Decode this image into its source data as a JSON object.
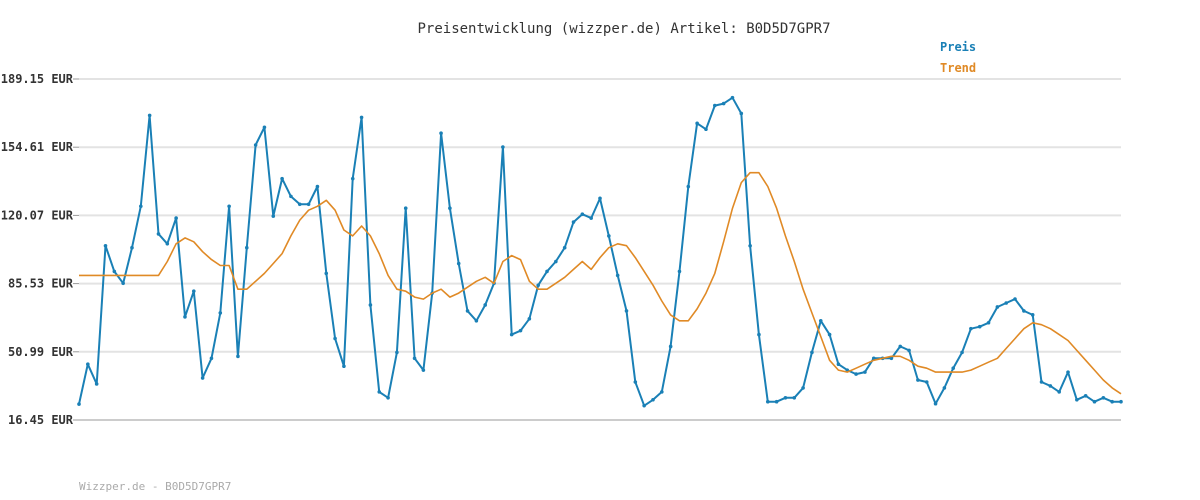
{
  "chart_data": {
    "type": "line",
    "title": "Preisentwicklung (wizzper.de) Artikel: B0D5D7GPR7",
    "xlabel": "",
    "ylabel": "",
    "ylim": [
      16.45,
      189.15
    ],
    "yticks": [
      "189.15 EUR",
      "154.61 EUR",
      "120.07 EUR",
      "85.53 EUR",
      "50.99 EUR",
      "16.45 EUR"
    ],
    "ytick_values": [
      189.15,
      154.61,
      120.07,
      85.53,
      50.99,
      16.45
    ],
    "grid": true,
    "legend_position": "top-right",
    "series": [
      {
        "name": "Preis",
        "color": "#1a80b6",
        "values": [
          24.5,
          44.7,
          34.7,
          104.7,
          91.7,
          85.7,
          103.7,
          124.7,
          170.7,
          110.7,
          105.7,
          118.7,
          68.7,
          81.7,
          37.7,
          47.7,
          70.7,
          124.7,
          48.7,
          103.7,
          155.7,
          164.7,
          119.7,
          138.7,
          129.7,
          125.7,
          125.7,
          134.7,
          90.7,
          57.7,
          43.7,
          138.7,
          169.7,
          74.7,
          30.7,
          27.7,
          50.7,
          123.7,
          47.7,
          41.7,
          80.7,
          161.7,
          123.7,
          95.7,
          71.7,
          66.7,
          74.7,
          85.7,
          154.7,
          59.7,
          61.7,
          67.7,
          84.7,
          91.7,
          96.7,
          103.7,
          116.7,
          120.7,
          118.7,
          128.7,
          109.7,
          89.7,
          71.7,
          35.7,
          23.7,
          26.7,
          30.7,
          53.7,
          91.7,
          134.7,
          166.7,
          163.7,
          175.7,
          176.7,
          179.7,
          171.7,
          104.7,
          59.7,
          25.7,
          25.7,
          27.7,
          27.7,
          32.7,
          50.7,
          66.7,
          59.7,
          44.7,
          41.7,
          39.7,
          40.7,
          47.7,
          47.7,
          47.7,
          53.7,
          51.7,
          36.7,
          35.7,
          24.7,
          32.7,
          42.7,
          50.7,
          62.7,
          63.7,
          65.7,
          73.7,
          75.7,
          77.7,
          71.7,
          69.7,
          35.7,
          33.7,
          30.7,
          40.7,
          26.7,
          28.7,
          25.7,
          27.7,
          25.7,
          25.7
        ]
      },
      {
        "name": "Trend",
        "color": "#e08a26",
        "values": [
          89.7,
          89.7,
          89.7,
          89.7,
          89.7,
          89.7,
          89.7,
          89.7,
          89.7,
          89.7,
          96.7,
          105.7,
          108.7,
          106.7,
          101.7,
          97.7,
          94.7,
          94.7,
          82.7,
          82.7,
          86.7,
          90.7,
          95.7,
          100.7,
          109.7,
          117.7,
          122.7,
          124.7,
          127.7,
          122.7,
          112.7,
          109.7,
          114.7,
          109.7,
          100.7,
          89.7,
          82.7,
          81.7,
          78.7,
          77.7,
          80.7,
          82.7,
          78.7,
          80.7,
          83.7,
          86.7,
          88.7,
          85.7,
          96.7,
          99.7,
          97.7,
          86.7,
          82.7,
          82.7,
          85.7,
          88.7,
          92.7,
          96.7,
          92.7,
          98.7,
          103.7,
          105.7,
          104.7,
          98.7,
          91.7,
          84.7,
          76.7,
          69.7,
          66.7,
          66.7,
          72.7,
          80.7,
          90.7,
          106.7,
          123.7,
          136.7,
          141.7,
          141.7,
          134.7,
          123.7,
          109.7,
          96.7,
          82.7,
          70.7,
          58.7,
          46.7,
          41.7,
          40.7,
          42.7,
          44.7,
          46.7,
          47.7,
          48.7,
          48.7,
          46.7,
          43.7,
          42.7,
          40.7,
          40.7,
          40.7,
          40.7,
          41.7,
          43.7,
          45.7,
          47.7,
          52.7,
          57.7,
          62.7,
          65.7,
          64.7,
          62.7,
          59.7,
          56.7,
          51.7,
          46.7,
          41.7,
          36.7,
          32.7,
          29.7
        ]
      }
    ]
  },
  "footer": "Wizzper.de - B0D5D7GPR7"
}
